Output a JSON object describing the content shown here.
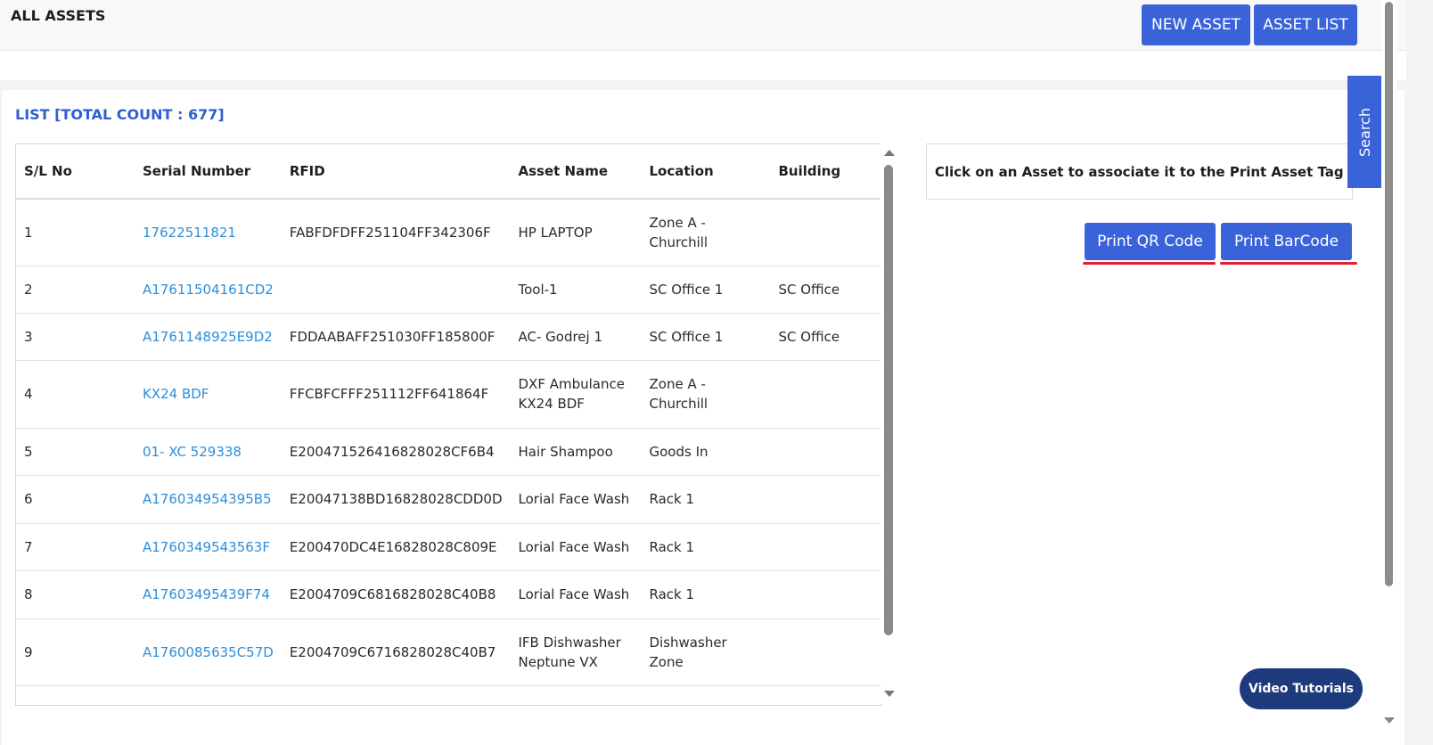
{
  "header": {
    "title": "ALL ASSETS",
    "new_asset_label": "NEW ASSET",
    "asset_list_label": "ASSET LIST"
  },
  "list": {
    "title": "LIST [TOTAL COUNT : 677]"
  },
  "table": {
    "columns": [
      "S/L No",
      "Serial Number",
      "RFID",
      "Asset Name",
      "Location",
      "Building"
    ],
    "rows": [
      {
        "sl": "1",
        "serial": "17622511821",
        "rfid": "FABFDFDFF251104FF342306F",
        "name": "HP LAPTOP",
        "location": "Zone A - Churchill",
        "building": ""
      },
      {
        "sl": "2",
        "serial": "A17611504161CD2",
        "rfid": "",
        "name": "Tool-1",
        "location": "SC Office 1",
        "building": "SC Office"
      },
      {
        "sl": "3",
        "serial": "A1761148925E9D2",
        "rfid": "FDDAABAFF251030FF185800F",
        "name": "AC- Godrej 1",
        "location": "SC Office 1",
        "building": "SC Office"
      },
      {
        "sl": "4",
        "serial": "KX24 BDF",
        "rfid": "FFCBFCFFF251112FF641864F",
        "name": "DXF Ambulance KX24 BDF",
        "location": "Zone A - Churchill",
        "building": ""
      },
      {
        "sl": "5",
        "serial": "01- XC 529338",
        "rfid": "E200471526416828028CF6B4",
        "name": "Hair Shampoo",
        "location": "Goods In",
        "building": ""
      },
      {
        "sl": "6",
        "serial": "A176034954395B5",
        "rfid": "E20047138BD16828028CDD0D",
        "name": "Lorial Face Wash",
        "location": "Rack 1",
        "building": ""
      },
      {
        "sl": "7",
        "serial": "A1760349543563F",
        "rfid": "E200470DC4E16828028C809E",
        "name": "Lorial Face Wash",
        "location": "Rack 1",
        "building": ""
      },
      {
        "sl": "8",
        "serial": "A17603495439F74",
        "rfid": "E2004709C6816828028C40B8",
        "name": "Lorial Face Wash",
        "location": "Rack 1",
        "building": ""
      },
      {
        "sl": "9",
        "serial": "A1760085635C57D",
        "rfid": "E2004709C6716828028C40B7",
        "name": "IFB Dishwasher Neptune VX",
        "location": "Dishwasher Zone",
        "building": ""
      }
    ]
  },
  "info": {
    "text": "Click on an Asset to associate it to the Print Asset Tag"
  },
  "print": {
    "qr_label": "Print QR Code",
    "barcode_label": "Print BarCode"
  },
  "search_tab": {
    "label": "Search"
  },
  "video_tutorials": {
    "label": "Video Tutorials"
  },
  "colors": {
    "primary": "#3b63d9",
    "link": "#2d8ed8",
    "accent_underline": "#e0202a",
    "dark_button": "#1d3a7c"
  }
}
